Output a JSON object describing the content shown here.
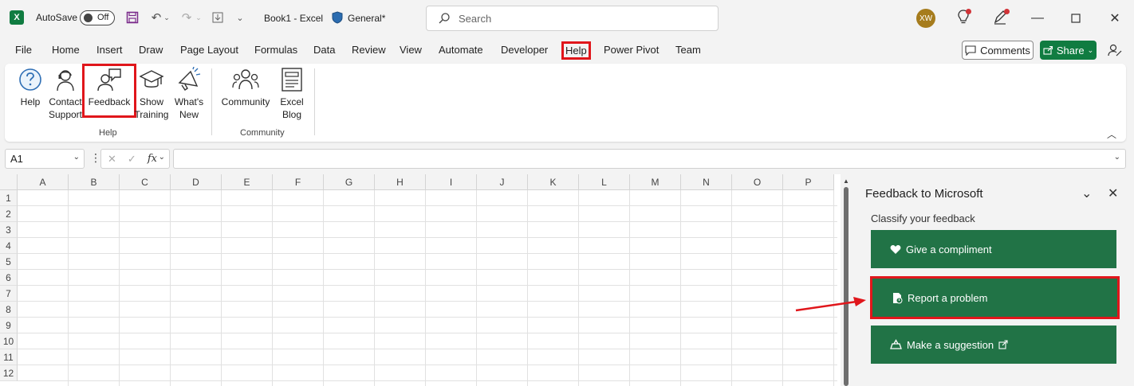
{
  "titlebar": {
    "app_logo": "X",
    "autosave_label": "AutoSave",
    "autosave_state": "Off",
    "doc_title": "Book1  -  Excel",
    "sensitivity": "General*",
    "search_placeholder": "Search",
    "avatar_initials": "XW"
  },
  "tabs": [
    "File",
    "Home",
    "Insert",
    "Draw",
    "Page Layout",
    "Formulas",
    "Data",
    "Review",
    "View",
    "Automate",
    "Developer",
    "Help",
    "Power Pivot",
    "Team"
  ],
  "actions": {
    "comments": "Comments",
    "share": "Share"
  },
  "ribbon": {
    "help_group": {
      "label": "Help",
      "buttons": [
        {
          "line1": "Help",
          "line2": ""
        },
        {
          "line1": "Contact",
          "line2": "Support"
        },
        {
          "line1": "Feedback",
          "line2": ""
        },
        {
          "line1": "Show",
          "line2": "Training"
        },
        {
          "line1": "What's",
          "line2": "New"
        }
      ]
    },
    "community_group": {
      "label": "Community",
      "buttons": [
        {
          "line1": "Community",
          "line2": ""
        },
        {
          "line1": "Excel",
          "line2": "Blog"
        }
      ]
    }
  },
  "formula_bar": {
    "name_box": "A1",
    "fx": "fx",
    "value": ""
  },
  "grid": {
    "columns": [
      "A",
      "B",
      "C",
      "D",
      "E",
      "F",
      "G",
      "H",
      "I",
      "J",
      "K",
      "L",
      "M",
      "N",
      "O",
      "P"
    ],
    "rows": [
      "1",
      "2",
      "3",
      "4",
      "5",
      "6",
      "7",
      "8",
      "9",
      "10",
      "11",
      "12"
    ]
  },
  "feedback_pane": {
    "title": "Feedback to Microsoft",
    "subtitle": "Classify your feedback",
    "buttons": [
      {
        "label": "Give a compliment",
        "icon": "heart-icon"
      },
      {
        "label": "Report a problem",
        "icon": "report-problem-icon"
      },
      {
        "label": "Make a suggestion",
        "icon": "lightbulb-icon"
      }
    ]
  },
  "colors": {
    "excel_green": "#107c41",
    "pane_button": "#217346",
    "highlight": "#e0161b"
  }
}
